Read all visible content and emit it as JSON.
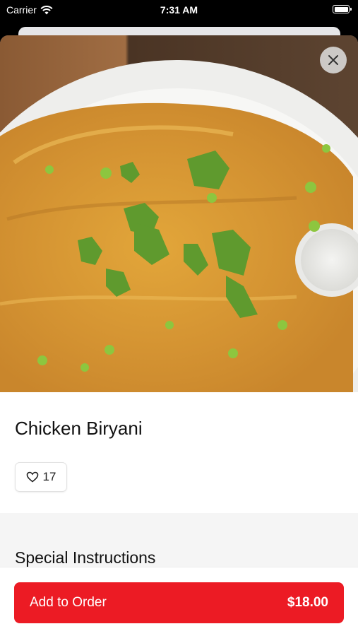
{
  "status_bar": {
    "carrier": "Carrier",
    "time": "7:31 AM"
  },
  "item": {
    "name": "Chicken Biryani",
    "likes": "17"
  },
  "sections": {
    "special_instructions": "Special Instructions"
  },
  "footer": {
    "add_label": "Add to Order",
    "price": "$18.00"
  },
  "colors": {
    "accent": "#ec1b24"
  },
  "icons": {
    "close": "close-icon",
    "heart": "heart-icon",
    "wifi": "wifi-icon",
    "battery": "battery-icon"
  }
}
